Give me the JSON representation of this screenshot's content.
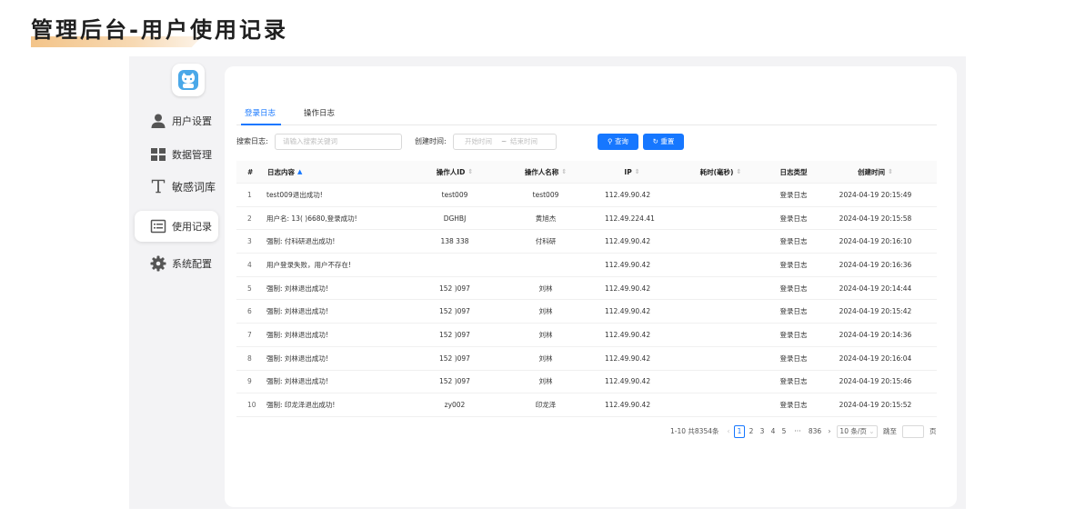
{
  "slide": {
    "title": "管理后台-用户使用记录"
  },
  "sidebar": {
    "items": [
      {
        "label": "用户设置",
        "icon": "user-icon",
        "active": false
      },
      {
        "label": "数据管理",
        "icon": "grid-icon",
        "active": false
      },
      {
        "label": "敏感词库",
        "icon": "text-t-icon",
        "active": false
      },
      {
        "label": "使用记录",
        "icon": "list-icon",
        "active": true
      },
      {
        "label": "系统配置",
        "icon": "gear-icon",
        "active": false
      }
    ]
  },
  "tabs": [
    {
      "label": "登录日志",
      "active": true
    },
    {
      "label": "操作日志",
      "active": false
    }
  ],
  "search": {
    "log_label": "搜索日志:",
    "log_placeholder": "请输入搜索关键词",
    "time_label": "创建时间:",
    "start_placeholder": "开始时间",
    "separator": "~",
    "end_placeholder": "结束时间",
    "query_button": "查询",
    "reset_button": "重置"
  },
  "table": {
    "columns": [
      "#",
      "日志内容",
      "操作人ID",
      "操作人名称",
      "IP",
      "耗时(毫秒)",
      "日志类型",
      "创建时间"
    ],
    "rows": [
      {
        "no": "1",
        "content": "test009退出成功!",
        "op_id": "test009",
        "op_name": "test009",
        "ip": "112.49.90.42",
        "cost": "",
        "type": "登录日志",
        "time": "2024-04-19 20:15:49"
      },
      {
        "no": "2",
        "content": "用户名: 13(      )6680,登录成功!",
        "op_id": "DGHBJ",
        "op_name": "黄旭杰",
        "ip": "112.49.224.41",
        "cost": "",
        "type": "登录日志",
        "time": "2024-04-19 20:15:58"
      },
      {
        "no": "3",
        "content": "强制: 付科研退出成功!",
        "op_id": "138        338",
        "op_name": "付科研",
        "ip": "112.49.90.42",
        "cost": "",
        "type": "登录日志",
        "time": "2024-04-19 20:16:10"
      },
      {
        "no": "4",
        "content": "用户登录失败，用户不存在!",
        "op_id": "",
        "op_name": "",
        "ip": "112.49.90.42",
        "cost": "",
        "type": "登录日志",
        "time": "2024-04-19 20:16:36"
      },
      {
        "no": "5",
        "content": "强制: 刘林退出成功!",
        "op_id": "152       )097",
        "op_name": "刘林",
        "ip": "112.49.90.42",
        "cost": "",
        "type": "登录日志",
        "time": "2024-04-19 20:14:44"
      },
      {
        "no": "6",
        "content": "强制: 刘林退出成功!",
        "op_id": "152       )097",
        "op_name": "刘林",
        "ip": "112.49.90.42",
        "cost": "",
        "type": "登录日志",
        "time": "2024-04-19 20:15:42"
      },
      {
        "no": "7",
        "content": "强制: 刘林退出成功!",
        "op_id": "152       )097",
        "op_name": "刘林",
        "ip": "112.49.90.42",
        "cost": "",
        "type": "登录日志",
        "time": "2024-04-19 20:14:36"
      },
      {
        "no": "8",
        "content": "强制: 刘林退出成功!",
        "op_id": "152       )097",
        "op_name": "刘林",
        "ip": "112.49.90.42",
        "cost": "",
        "type": "登录日志",
        "time": "2024-04-19 20:16:04"
      },
      {
        "no": "9",
        "content": "强制: 刘林退出成功!",
        "op_id": "152       )097",
        "op_name": "刘林",
        "ip": "112.49.90.42",
        "cost": "",
        "type": "登录日志",
        "time": "2024-04-19 20:15:46"
      },
      {
        "no": "10",
        "content": "强制: 印龙泽退出成功!",
        "op_id": "zy002",
        "op_name": "印龙泽",
        "ip": "112.49.90.42",
        "cost": "",
        "type": "登录日志",
        "time": "2024-04-19 20:15:52"
      }
    ]
  },
  "pagination": {
    "summary": "1-10 共8354条",
    "pages": [
      "1",
      "2",
      "3",
      "4",
      "5"
    ],
    "ellipsis": "···",
    "last_page": "836",
    "current": "1",
    "page_size": "10 条/页",
    "jump_label": "跳至",
    "page_suffix": "页"
  },
  "colors": {
    "accent": "#1677ff",
    "title_highlight": "#f3c489",
    "frame_bg": "#f3f3f5"
  }
}
